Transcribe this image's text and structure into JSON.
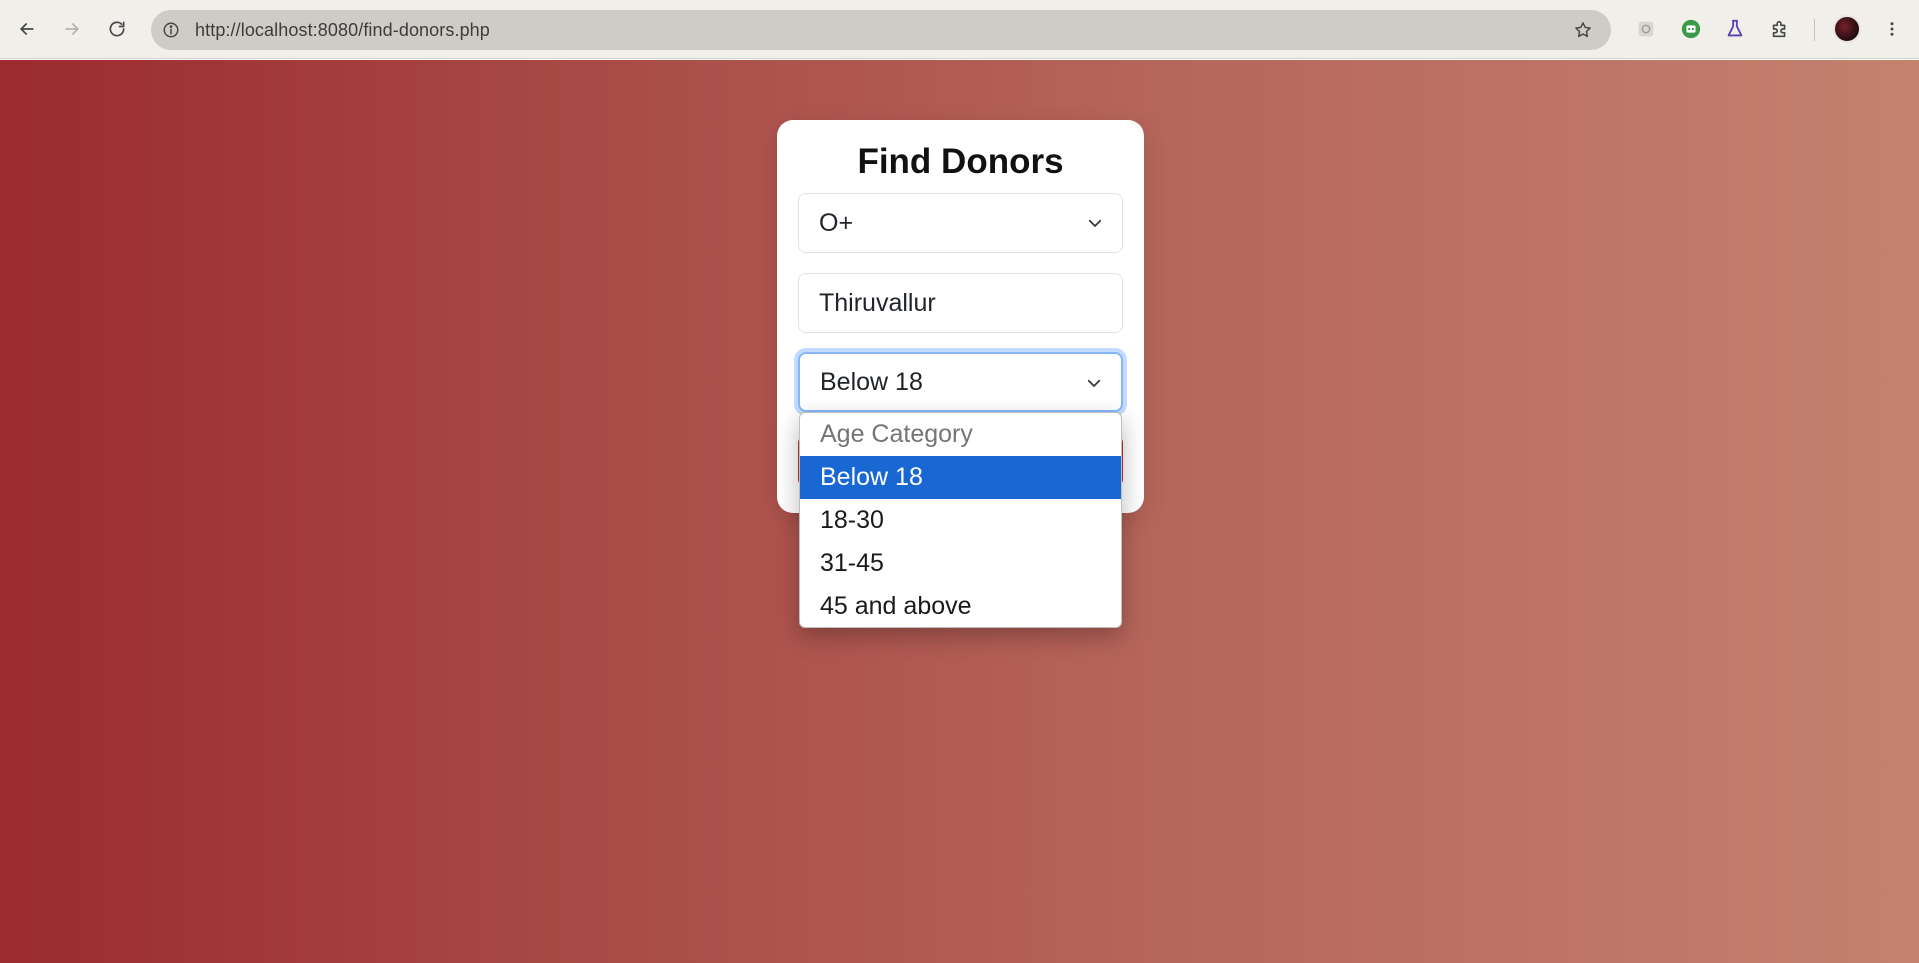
{
  "browser": {
    "url": "http://localhost:8080/find-donors.php",
    "icons": {
      "back": "arrow-left-icon",
      "forward": "arrow-right-icon",
      "reload": "reload-icon",
      "site_info": "info-icon",
      "bookmark": "star-icon",
      "menu": "kebab-icon"
    }
  },
  "form": {
    "title": "Find Donors",
    "blood_group": {
      "value": "O+"
    },
    "location": {
      "value": "Thiruvallur"
    },
    "age_category": {
      "value": "Below 18",
      "options": [
        {
          "label": "Age Category",
          "placeholder": true
        },
        {
          "label": "Below 18",
          "selected": true
        },
        {
          "label": "18-30"
        },
        {
          "label": "31-45"
        },
        {
          "label": "45 and above"
        }
      ]
    }
  },
  "colors": {
    "page_gradient_start": "#9b2b2f",
    "page_gradient_end": "#c4826f",
    "selected_option": "#1967d2",
    "focus_ring": "#86b7fe"
  }
}
